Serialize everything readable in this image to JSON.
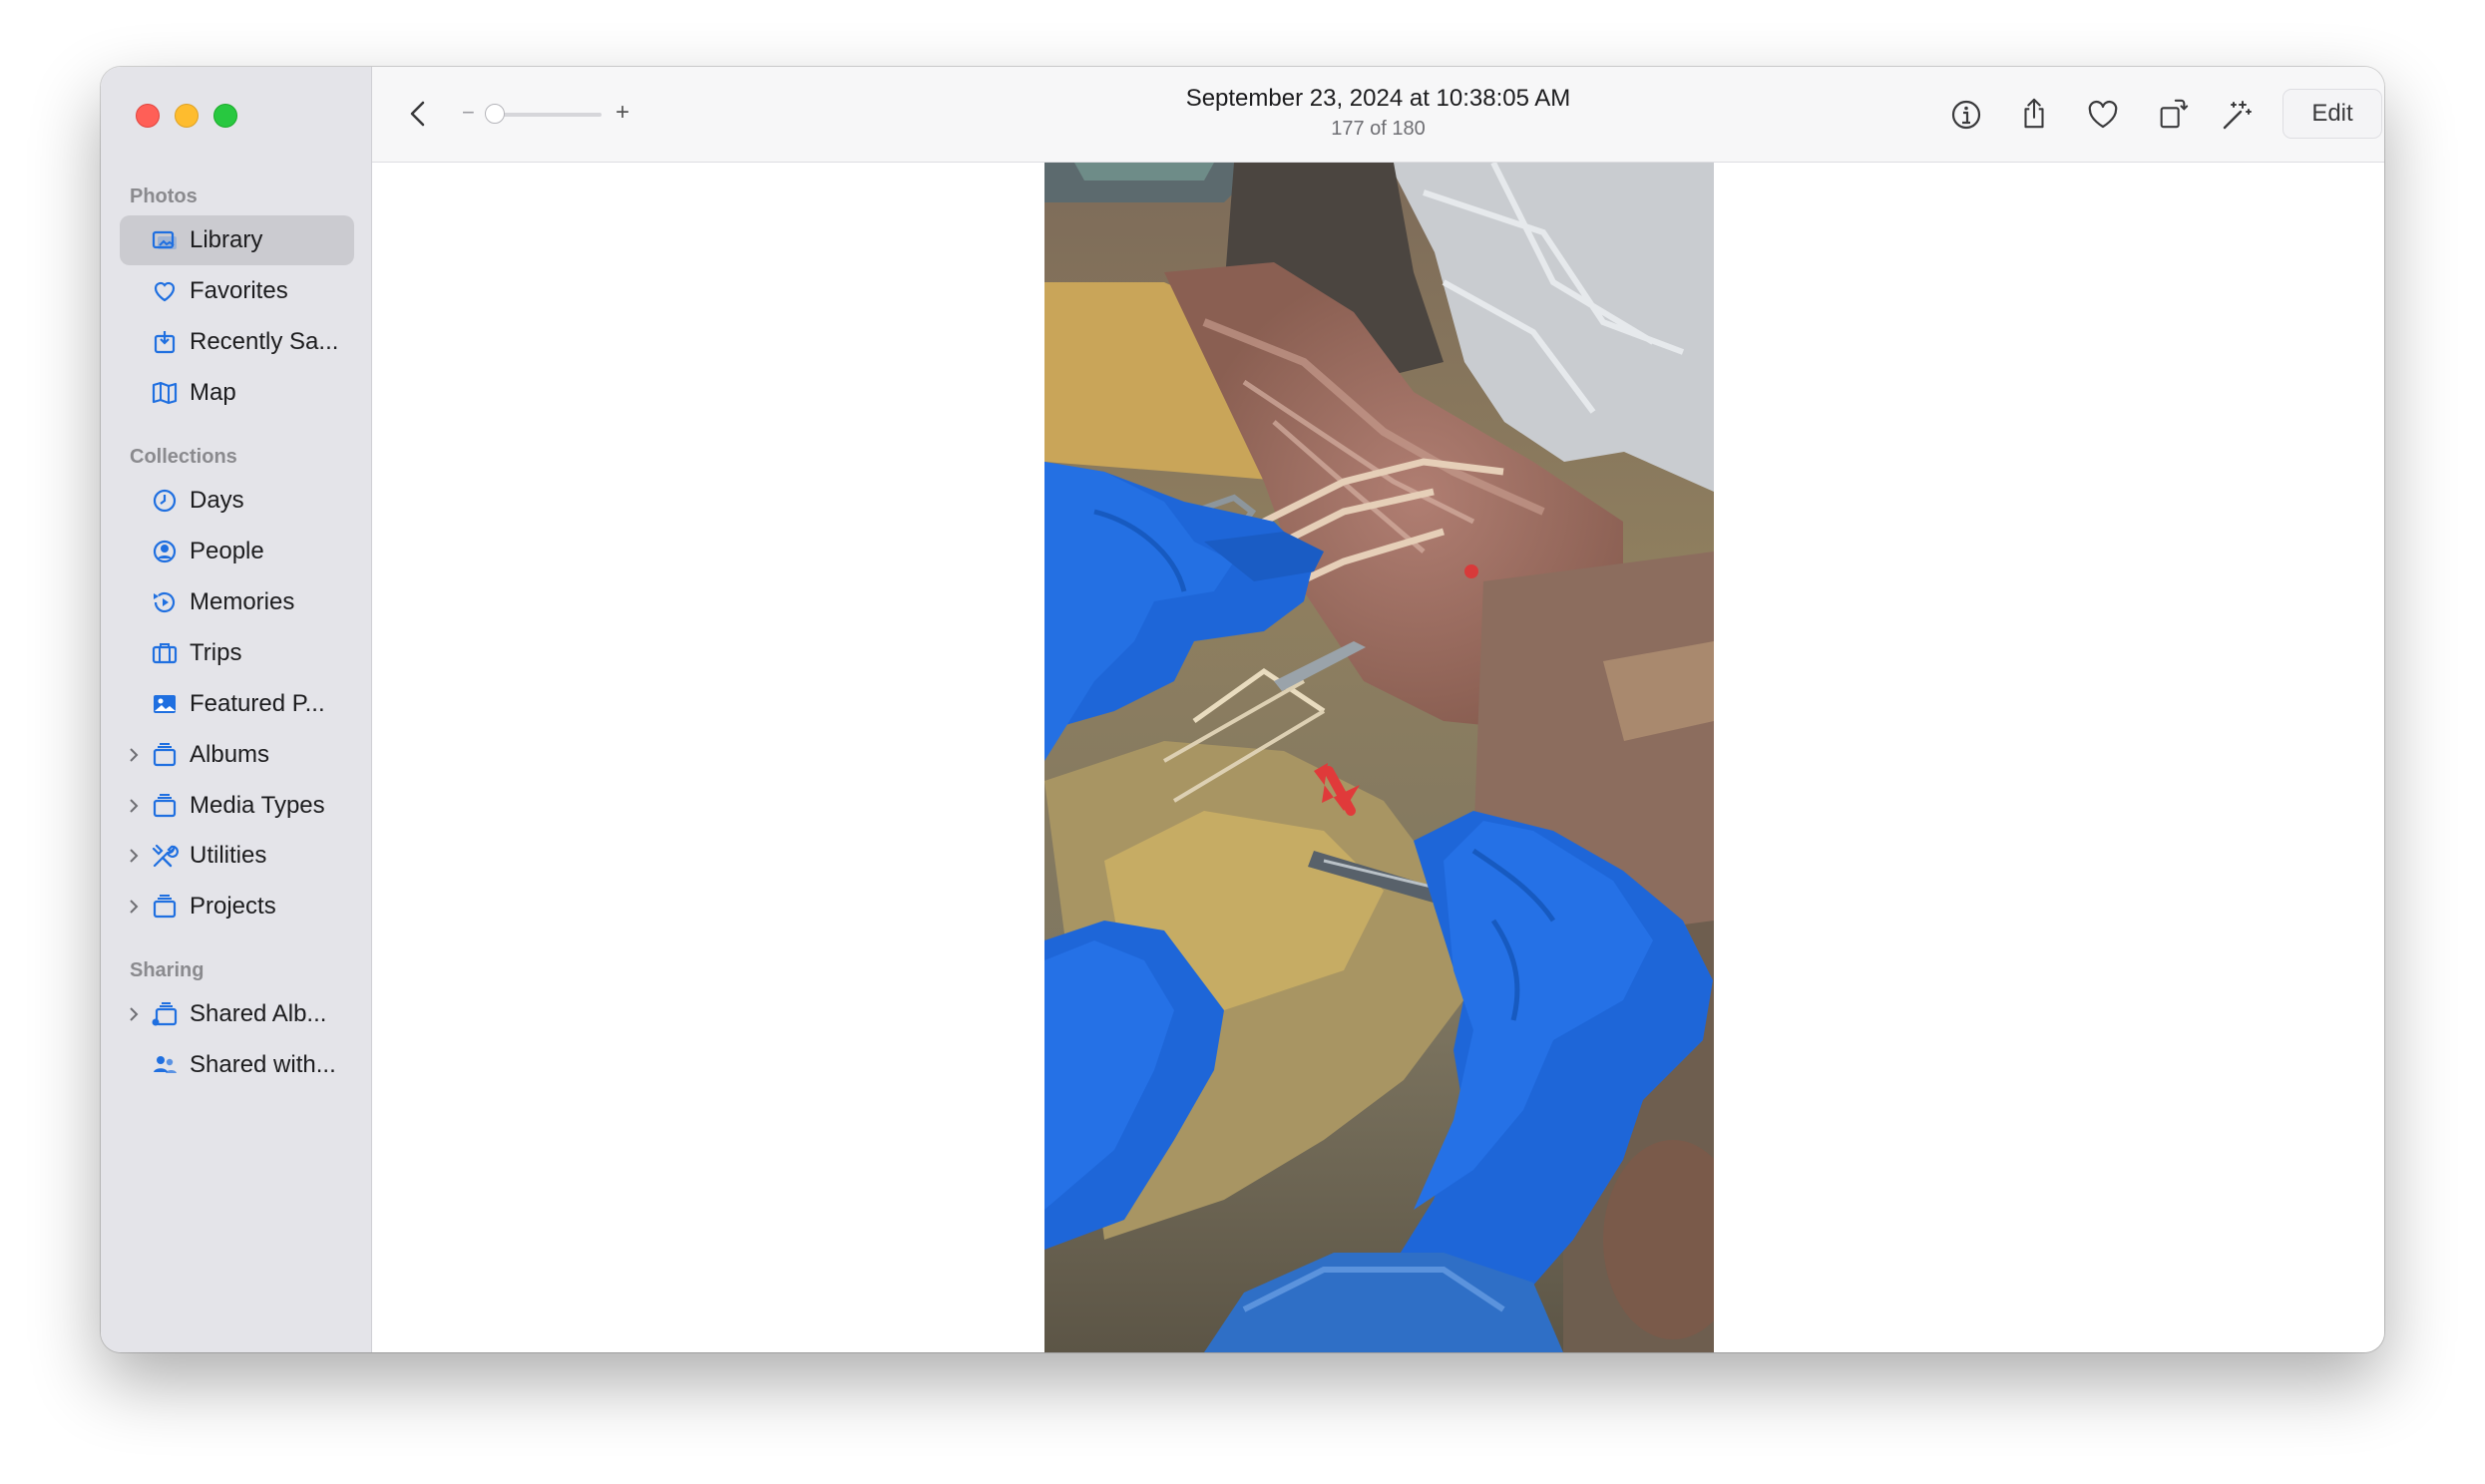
{
  "window": {
    "traffic_lights": [
      "close",
      "minimize",
      "maximize"
    ]
  },
  "sidebar": {
    "sections": [
      {
        "title": "Photos",
        "items": [
          {
            "label": "Library",
            "icon": "library-icon",
            "active": true
          },
          {
            "label": "Favorites",
            "icon": "heart-icon"
          },
          {
            "label": "Recently Sa...",
            "icon": "recently-saved-icon"
          },
          {
            "label": "Map",
            "icon": "map-icon"
          }
        ]
      },
      {
        "title": "Collections",
        "items": [
          {
            "label": "Days",
            "icon": "clock-icon"
          },
          {
            "label": "People",
            "icon": "person-circle-icon"
          },
          {
            "label": "Memories",
            "icon": "memories-icon"
          },
          {
            "label": "Trips",
            "icon": "suitcase-icon"
          },
          {
            "label": "Featured P...",
            "icon": "photo-icon"
          },
          {
            "label": "Albums",
            "icon": "album-stack-icon",
            "expandable": true
          },
          {
            "label": "Media Types",
            "icon": "album-stack-icon",
            "expandable": true
          },
          {
            "label": "Utilities",
            "icon": "tools-icon",
            "expandable": true
          },
          {
            "label": "Projects",
            "icon": "album-stack-icon",
            "expandable": true
          }
        ]
      },
      {
        "title": "Sharing",
        "items": [
          {
            "label": "Shared Alb...",
            "icon": "shared-album-icon",
            "expandable": true
          },
          {
            "label": "Shared with...",
            "icon": "shared-people-icon"
          }
        ]
      }
    ]
  },
  "toolbar": {
    "title": "September 23, 2024 at 10:38:05 AM",
    "subtitle": "177 of 180",
    "zoom_minus": "−",
    "zoom_plus": "+",
    "zoom_level": 0,
    "edit_label": "Edit",
    "icons": [
      "back-chevron-icon",
      "info-icon",
      "share-icon",
      "favorite-heart-icon",
      "rotate-icon",
      "auto-enhance-icon"
    ]
  },
  "colors": {
    "accent": "#1f6fe0",
    "sidebar_bg": "#e4e4e9",
    "selection": "#cbcbd0",
    "glove_blue": "#1e66d8"
  }
}
